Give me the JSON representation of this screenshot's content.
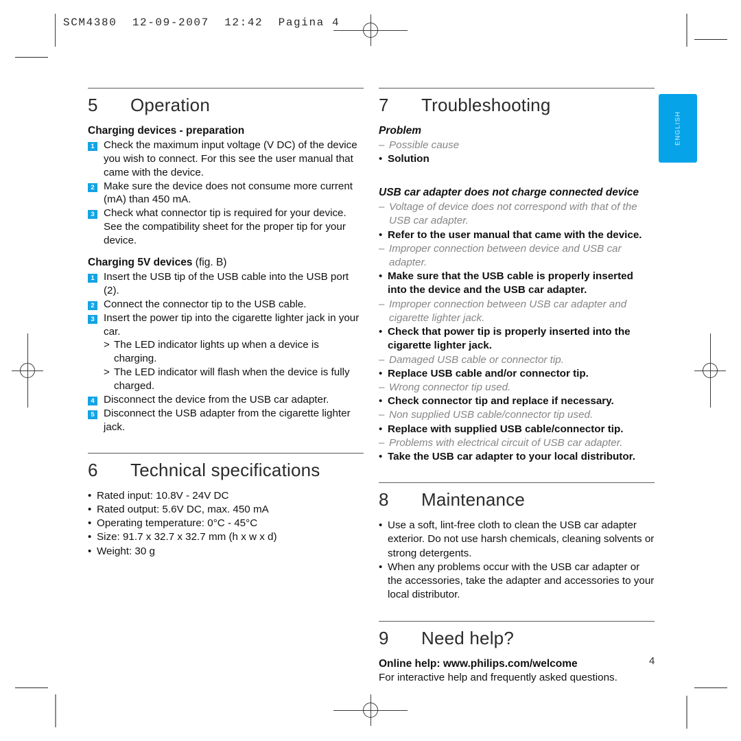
{
  "slug": {
    "text": "SCM4380  12-09-2007  12:42  Pagina 4"
  },
  "language_tab": {
    "label": "ENGLISH",
    "color": "#06A3E9"
  },
  "folio": {
    "page_number": "4"
  },
  "marker_color": "#14A3E4",
  "left_column": {
    "section5": {
      "number": "5",
      "title": "Operation",
      "sub1": {
        "heading": "Charging devices - preparation"
      },
      "steps1": [
        "Check the maximum input voltage (V DC) of the device you wish to connect. For this see the user manual that came with the device.",
        "Make sure the device does not consume more current (mA) than 450 mA.",
        "Check what connector tip is required for your device. See the compatibility sheet for the proper tip for your device."
      ],
      "sub2": {
        "heading": "Charging 5V devices",
        "note": "(fig. B)"
      },
      "steps2": [
        "Insert the USB tip of the USB cable into the USB port (2).",
        "Connect the connector tip to the USB cable.",
        "Insert the power tip into the cigarette lighter jack in your car."
      ],
      "results": [
        "The LED indicator lights up when a device is charging.",
        "The LED indicator will flash when the device is fully charged."
      ],
      "steps3": [
        {
          "num": "4",
          "text": "Disconnect the device from the USB car adapter."
        },
        {
          "num": "5",
          "text": "Disconnect the USB adapter from the cigarette lighter jack."
        }
      ],
      "result_marker": ">"
    },
    "section6": {
      "number": "6",
      "title": "Technical specifications",
      "bullets": [
        "Rated input: 10.8V - 24V DC",
        "Rated output: 5.6V DC, max. 450 mA",
        "Operating temperature: 0°C - 45°C",
        "Size: 91.7 x 32.7 x 32.7 mm (h x w x d)",
        "Weight: 30 g"
      ]
    }
  },
  "right_column": {
    "section7": {
      "number": "7",
      "title": "Troubleshooting",
      "legend": {
        "problem": "Problem",
        "cause": "Possible cause",
        "solution": "Solution"
      },
      "problem_heading": "USB car adapter does not charge connected device",
      "entries": [
        {
          "cause": "Voltage of device does not correspond with that of the USB car adapter.",
          "solution": "Refer to the user manual that came with the device."
        },
        {
          "cause": "Improper connection between device and USB car adapter.",
          "solution": "Make sure that the USB cable is properly inserted into the device and the USB car adapter."
        },
        {
          "cause": "Improper connection between USB car adapter and cigarette lighter jack.",
          "solution": "Check that power tip is properly inserted into the cigarette lighter jack."
        },
        {
          "cause": "Damaged USB cable or connector tip.",
          "solution": "Replace USB cable and/or connector tip."
        },
        {
          "cause": "Wrong connector tip used.",
          "solution": "Check connector tip and replace if necessary."
        },
        {
          "cause": "Non supplied USB cable/connector tip used.",
          "solution": "Replace with supplied USB cable/connector tip."
        },
        {
          "cause": "Problems with electrical circuit of USB car adapter.",
          "solution": "Take the USB car adapter to your local distributor."
        }
      ]
    },
    "section8": {
      "number": "8",
      "title": "Maintenance",
      "bullets": [
        "Use a soft, lint-free cloth to clean the USB car adapter exterior. Do not use harsh chemicals, cleaning solvents or strong detergents.",
        "When any problems occur with the USB car adapter or the accessories, take the adapter and accessories to your local distributor."
      ]
    },
    "section9": {
      "number": "9",
      "title": "Need help?",
      "online_help": "Online help: www.philips.com/welcome",
      "online_help_desc": "For interactive help and frequently asked questions."
    }
  }
}
